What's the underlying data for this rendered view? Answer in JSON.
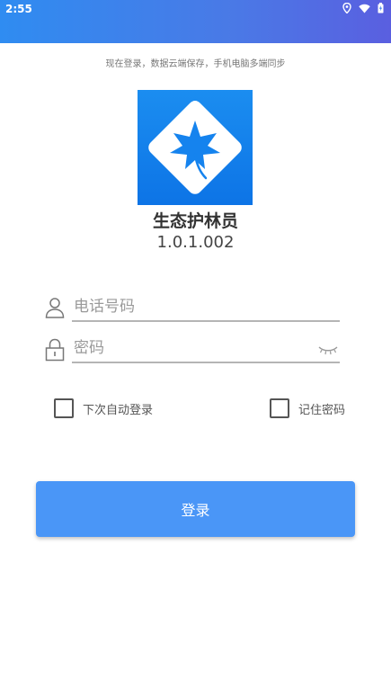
{
  "status_bar": {
    "time": "2:55",
    "icons": [
      "location-icon",
      "wifi-icon",
      "battery-icon"
    ],
    "gradient_colors": [
      "#2f8cf1",
      "#5a5fe0"
    ]
  },
  "header": {
    "subtitle": "现在登录，数据云端保存，手机电脑多端同步"
  },
  "app": {
    "name": "生态护林员",
    "version": "1.0.1.002",
    "logo_icon": "maple-leaf-diamond-icon",
    "logo_color": "#1b8df0"
  },
  "form": {
    "phone_placeholder": "电话号码",
    "password_placeholder": "密码",
    "phone_icon": "user-icon",
    "password_icon": "lock-icon",
    "toggle_icon": "eye-closed-icon",
    "auto_login_label": "下次自动登录",
    "remember_password_label": "记住密码",
    "login_label": "登录",
    "accent_color": "#4a96f7"
  }
}
